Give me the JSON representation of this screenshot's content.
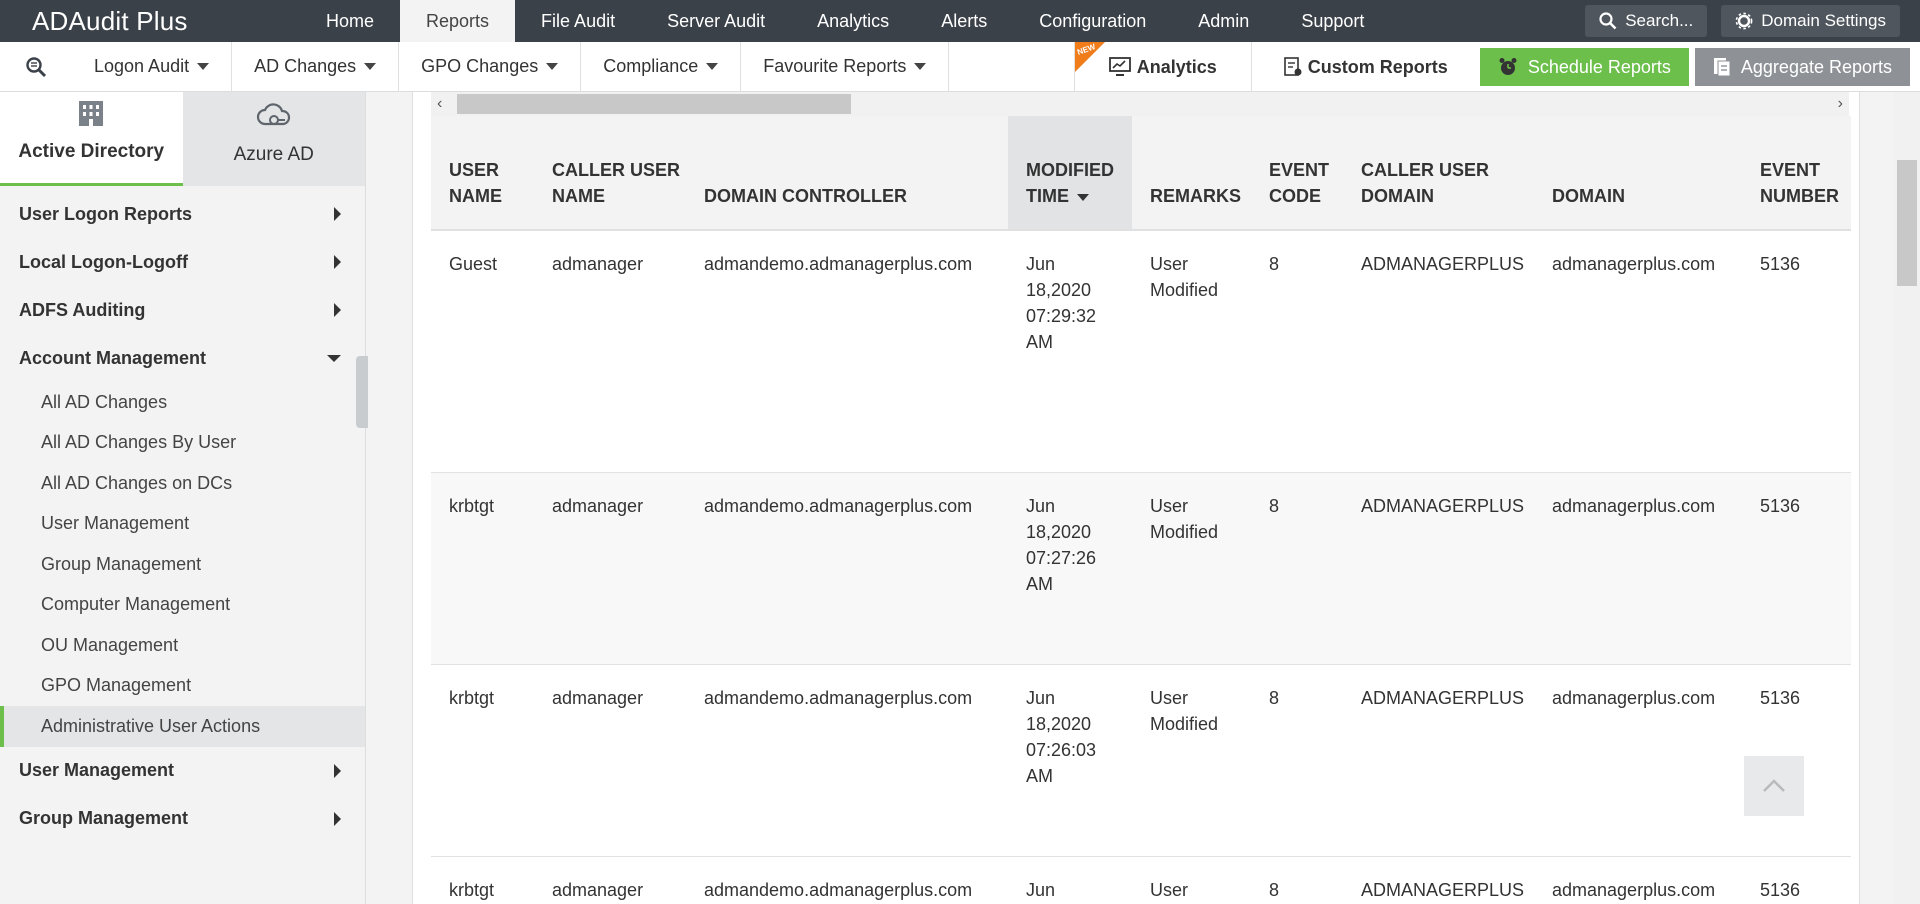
{
  "app": {
    "logo": "ADAudit Plus"
  },
  "topnav": {
    "items": [
      "Home",
      "Reports",
      "File Audit",
      "Server Audit",
      "Analytics",
      "Alerts",
      "Configuration",
      "Admin",
      "Support"
    ],
    "active": "Reports",
    "search_label": "Search...",
    "domain_settings_label": "Domain Settings"
  },
  "subnav": {
    "items": [
      "Logon Audit",
      "AD Changes",
      "GPO Changes",
      "Compliance",
      "Favourite Reports"
    ],
    "analytics_label": "Analytics",
    "new_tag": "NEW",
    "custom_reports_label": "Custom Reports",
    "schedule_reports_label": "Schedule Reports",
    "aggregate_reports_label": "Aggregate Reports"
  },
  "sidebar": {
    "tabs": [
      "Active Directory",
      "Azure AD"
    ],
    "active_tab": "Active Directory",
    "menu": [
      {
        "label": "User Logon Reports",
        "expanded": false
      },
      {
        "label": "Local Logon-Logoff",
        "expanded": false
      },
      {
        "label": "ADFS Auditing",
        "expanded": false
      },
      {
        "label": "Account Management",
        "expanded": true
      }
    ],
    "sub_items": [
      "All AD Changes",
      "All AD Changes By User",
      "All AD Changes on DCs",
      "User Management",
      "Group Management",
      "Computer Management",
      "OU Management",
      "GPO Management",
      "Administrative User Actions"
    ],
    "active_sub": "Administrative User Actions",
    "menu_after": [
      {
        "label": "User Management",
        "expanded": false
      },
      {
        "label": "Group Management",
        "expanded": false
      }
    ]
  },
  "table": {
    "columns": [
      "USER NAME",
      "CALLER USER NAME",
      "DOMAIN CONTROLLER",
      "MODIFIED TIME",
      "REMARKS",
      "EVENT CODE",
      "CALLER USER DOMAIN",
      "DOMAIN",
      "EVENT NUMBER"
    ],
    "sorted_column": "MODIFIED TIME",
    "rows": [
      [
        "Guest",
        "admanager",
        "admandemo.admanagerplus.com",
        "Jun 18,2020 07:29:32 AM",
        "User Modified",
        "8",
        "ADMANAGERPLUS",
        "admanagerplus.com",
        "5136"
      ],
      [
        "krbtgt",
        "admanager",
        "admandemo.admanagerplus.com",
        "Jun 18,2020 07:27:26 AM",
        "User Modified",
        "8",
        "ADMANAGERPLUS",
        "admanagerplus.com",
        "5136"
      ],
      [
        "krbtgt",
        "admanager",
        "admandemo.admanagerplus.com",
        "Jun 18,2020 07:26:03 AM",
        "User Modified",
        "8",
        "ADMANAGERPLUS",
        "admanagerplus.com",
        "5136"
      ],
      [
        "krbtgt",
        "admanager",
        "admandemo.admanagerplus.com",
        "Jun",
        "User",
        "8",
        "ADMANAGERPLUS",
        "admanagerplus.com",
        "5136"
      ]
    ]
  },
  "colors": {
    "topbar": "#3b4148",
    "accent_green": "#6cbf4a",
    "new_orange": "#f07c1a",
    "aggregate_gray": "#8e9296"
  }
}
